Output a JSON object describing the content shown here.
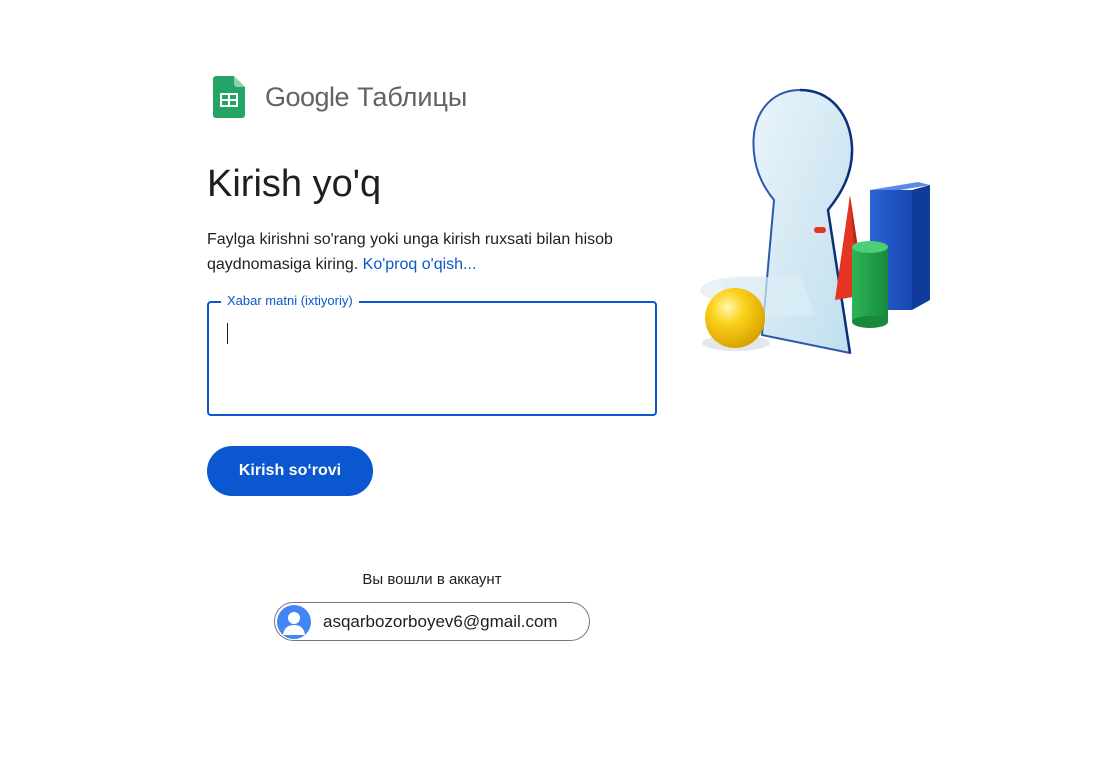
{
  "app": {
    "brand_google": "Google",
    "brand_product": "Таблицы"
  },
  "main": {
    "heading": "Kirish yo'q",
    "description": "Faylga kirishni so'rang yoki unga kirish ruxsati bilan hisob qaydnomasiga kiring.",
    "learn_more_link": "Ko'proq o'qish...",
    "message_field": {
      "label": "Xabar matni (ixtiyoriy)",
      "value": ""
    },
    "request_button_label": "Kirish so‘rovi"
  },
  "account": {
    "signed_in_text": "Вы вошли в аккаунт",
    "email": "asqarbozorboyev6@gmail.com"
  },
  "colors": {
    "accent": "#0b57d0",
    "sheets_green": "#23a566",
    "avatar_blue": "#4285f4"
  },
  "icons": {
    "app_icon": "google-sheets-icon",
    "avatar_icon": "person-icon"
  }
}
